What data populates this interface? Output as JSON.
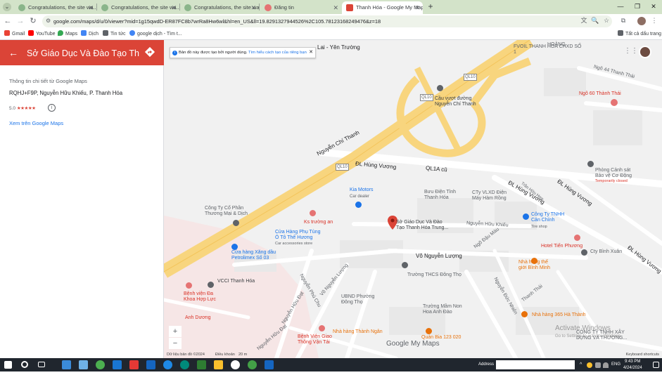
{
  "browser": {
    "tabs": [
      {
        "label": "Congratulations, the site wa...",
        "active": false
      },
      {
        "label": "Congratulations, the site wa...",
        "active": false
      },
      {
        "label": "Congratulations, the site wa...",
        "active": false
      },
      {
        "label": "Đăng tin",
        "active": false
      },
      {
        "label": "Thanh Hóa - Google My Maps",
        "active": true
      }
    ],
    "url": "google.com/maps/d/u/0/viewer?mid=1g15qwdD-ER87FC8b7wrRa8Hw6wl&hl=en_US&ll=19.8291327944526%2C105.78123168249476&z=18",
    "bookmarks": [
      {
        "label": "Gmail",
        "color": "#ea4335"
      },
      {
        "label": "YouTube",
        "color": "#ff0000"
      },
      {
        "label": "Maps",
        "color": "#34a853"
      },
      {
        "label": "Dịch",
        "color": "#4285f4"
      },
      {
        "label": "Tin tức",
        "color": "#5f6368"
      },
      {
        "label": "google dịch - Tìm t...",
        "color": "#4285f4"
      }
    ],
    "all_bookmarks": "Tất cả dấu trang"
  },
  "side_panel": {
    "title": "Sở Giáo Dục Và Đào Tạo Thanh...",
    "details_heading": "Thông tin chi tiết từ Google Maps",
    "address": "RQHJ+F9P, Nguyễn Hữu Khiếu, P. Thanh Hóa",
    "rating": "5.0",
    "stars": "★★★★★",
    "rating_value": 5,
    "view_link": "Xem trên Google Maps",
    "header_color": "#db4437"
  },
  "map": {
    "notice_text": "Bản đồ này được tạo bởi người dùng.",
    "notice_link": "Tìm hiểu cách tạo của riêng bạn",
    "labels": {
      "lai_yen_truong": "Lai - Yên Trường",
      "fvoil": "FVOIL THANH HOA CHXD SỐ 1",
      "hoang": "HOÀNG",
      "ngo44": "Ngõ 44 Thanh Thái",
      "ngo60": "Ngõ 60 Thành Thái",
      "ql10_top": "QL10",
      "ql10_mid": "QL10",
      "ql10_left": "QL10",
      "cau_vuot": "Cầu vượt đường\nNguyễn Chí Thanh",
      "nguyen_chi_thanh": "Nguyễn Chí Thanh",
      "dl_hung_vuong": "ĐL Hùng Vương",
      "ql1a": "QL1A cũ",
      "dl_hung_vuong_2": "ĐL Hùng Vương",
      "dl_hung_vuong_3": "ĐL Hùng Vương",
      "dl_hung_vuong_4": "ĐL Hùng Vương",
      "tran_huu_hop": "Trần Hữu Hợp",
      "phong_canh_sat": "Phòng Cảnh sát\nBảo vệ Cơ Động",
      "temporarily": "Temporarily closed",
      "kia": "Kia Motors",
      "car_dealer": "Car dealer",
      "buu_dien": "Bưu Điện Tỉnh\nThanh Hóa",
      "cty_vlxd": "CTy VLXD Điện\nMáy Hàm Rồng",
      "cong_ty_cp": "Công Ty Cổ Phần\nThương Mại & Dịch",
      "ks_truong_an": "Ks trường an",
      "cua_hang_phu_tung": "Cửa Hàng Phụ Tùng\nÔ Tô Thế Hương",
      "car_accessories": "Car accessories store",
      "so_gd_label": "Sở Giáo Dục Và Đào\nTạo Thanh Hóa Trung...",
      "nguyen_huu_khieu": "Nguyễn Hữu Khiếu",
      "cong_ty_tnhh": "Công Ty TNHH\nCản Chính",
      "tire_shop": "Tire shop",
      "cua_hang_xang": "Cửa hàng Xăng dầu\nPetrolimex Số 03",
      "ngoc_dau_mau": "Ngõ Đậu Màu",
      "hotel_tien_phuong": "Hotel Tiến Phương",
      "vo_nguyen_luong": "Võ Nguyễn Lượng",
      "cty_binh_xuan": "Cty Bình Xuân",
      "truong_thcs": "Trường THCS Đông Thọ",
      "nha_hang_binh_minh": "Nhà hàng thế\ngiới Bình Minh",
      "vcci": "VCCI Thanh Hóa",
      "vo_nguyen_luong_2": "Võ Nguyễn Lượng",
      "nguyen_phu_chu": "Nguyễn Phú Chu",
      "ubnd": "UBND Phường\nĐông Thọ",
      "benh_vien": "Bệnh viện Đa\nKhoa Hợp Lực",
      "nguyen_duc_nhien": "Nguyễn Đức Nhiên",
      "thanh_thai": "Thanh Thái",
      "truong_mam_non": "Trường Mầm Non\nHoa Anh Đào",
      "nguyen_huu_dat": "Nguyễn Hữu Đạt",
      "nha_hang_365": "Nhà hàng 365 Hà Thành",
      "anh_duong": "Anh Dương",
      "benh_vien_gtvt": "Bệnh Viện Giao\nThông Vận Tải",
      "nha_hang_thanh_ngan": "Nhà hàng Thành Ngân",
      "quan_bia": "Quán Bia 123 020",
      "cong_ty_tnhh_xay": "CÔNG TY TNHH XÂY\nDỰNG VÀ THƯƠNG...",
      "nguyen_huu_dat_2": "Nguyễn Hữu Đạt"
    },
    "zoom_in": "+",
    "zoom_out": "−",
    "attribution_left": "Dữ liệu bản đồ ©2024",
    "attribution_terms": "Điều khoản",
    "attribution_scale": "20 m",
    "attribution_right": "Keyboard shortcuts",
    "logo": "Google My Maps",
    "activate_windows": "Activate Windows",
    "activate_windows_sub": "Go to Settings to activate Windows."
  },
  "taskbar": {
    "address_label": "Address",
    "lang": "ENG",
    "time": "9:43 PM",
    "date": "4/24/2024"
  }
}
